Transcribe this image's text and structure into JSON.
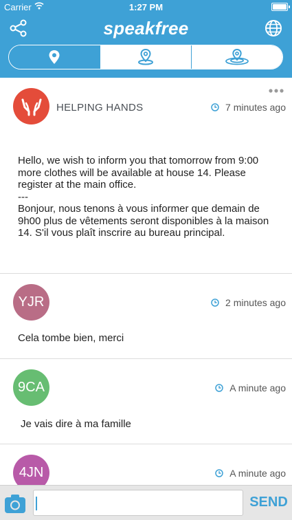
{
  "status_bar": {
    "carrier": "Carrier",
    "time": "1:27 PM"
  },
  "header": {
    "title": "speakfree",
    "tabs": [
      {
        "icon": "location-pin-icon",
        "active": true
      },
      {
        "icon": "nearby-location-icon",
        "active": false
      },
      {
        "icon": "wide-area-location-icon",
        "active": false
      }
    ]
  },
  "colors": {
    "brand": "#3ea1d6",
    "helping_hands": "#e44c3a",
    "yjr": "#b96d86",
    "nineca": "#67bd72",
    "fourjn": "#b85aa8"
  },
  "posts": [
    {
      "author": "HELPING HANDS",
      "avatar_icon": "helping-hands-icon",
      "time": "7 minutes ago",
      "text": "Hello, we wish to inform you that tomorrow from 9:00 more clothes will be available at house 14. Please register at the main office.\n ---\nBonjour, nous tenons à vous informer que demain de 9h00 plus de vêtements seront disponibles à la maison 14. S'il vous plaît inscrire au bureau principal."
    },
    {
      "avatar": "YJR",
      "time": "2 minutes ago",
      "text": "Cela tombe bien, merci"
    },
    {
      "avatar": "9CA",
      "time": "A minute ago",
      "text": "Je vais dire à ma famille"
    },
    {
      "avatar": "4JN",
      "time": "A minute ago"
    }
  ],
  "composer": {
    "input_value": "",
    "send_label": "SEND"
  }
}
